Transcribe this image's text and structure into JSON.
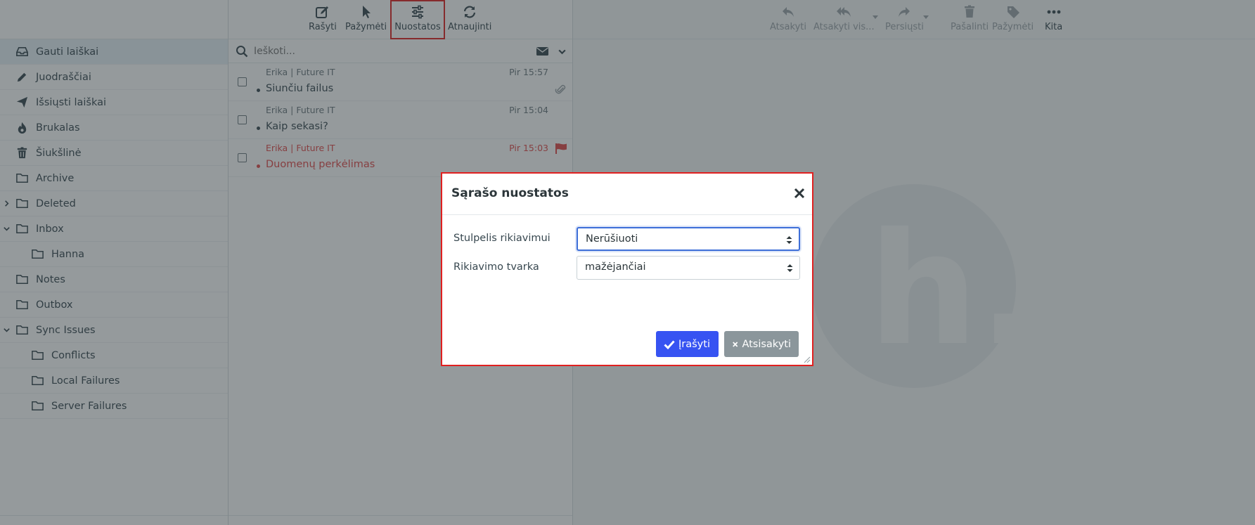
{
  "main_toolbar": {
    "compose": "Rašyti",
    "select": "Pažymėti",
    "options": "Nuostatos",
    "refresh": "Atnaujinti"
  },
  "preview_toolbar": {
    "reply": "Atsakyti",
    "reply_all": "Atsakyti vis...",
    "forward": "Persiųsti",
    "delete": "Pašalinti",
    "mark": "Pažymėti",
    "more": "Kita"
  },
  "sidebar": {
    "folders": [
      {
        "label": "Gauti laiškai",
        "icon": "inbox-icon",
        "selected": true
      },
      {
        "label": "Juodraščiai",
        "icon": "pencil-icon"
      },
      {
        "label": "Išsiųsti laiškai",
        "icon": "paper-plane-icon"
      },
      {
        "label": "Brukalas",
        "icon": "fire-icon"
      },
      {
        "label": "Šiukšlinė",
        "icon": "trash-icon"
      },
      {
        "label": "Archive",
        "icon": "folder-icon"
      },
      {
        "label": "Deleted",
        "icon": "folder-icon",
        "collapsed": true
      },
      {
        "label": "Inbox",
        "icon": "folder-icon",
        "expanded": true
      },
      {
        "label": "Hanna",
        "icon": "folder-icon",
        "level": 1
      },
      {
        "label": "Notes",
        "icon": "folder-icon"
      },
      {
        "label": "Outbox",
        "icon": "folder-icon"
      },
      {
        "label": "Sync Issues",
        "icon": "folder-icon",
        "expanded": true
      },
      {
        "label": "Conflicts",
        "icon": "folder-icon",
        "level": 1
      },
      {
        "label": "Local Failures",
        "icon": "folder-icon",
        "level": 1
      },
      {
        "label": "Server Failures",
        "icon": "folder-icon",
        "level": 1
      }
    ]
  },
  "search": {
    "placeholder": "Ieškoti..."
  },
  "messages": [
    {
      "from": "Erika | Future IT",
      "date": "Pir 15:57",
      "subject": "Siunčiu failus",
      "attachment": true,
      "flagged": false
    },
    {
      "from": "Erika | Future IT",
      "date": "Pir 15:04",
      "subject": "Kaip sekasi?",
      "attachment": false,
      "flagged": false
    },
    {
      "from": "Erika | Future IT",
      "date": "Pir 15:03",
      "subject": "Duomenų perkėlimas",
      "attachment": false,
      "flagged": true
    }
  ],
  "dialog": {
    "title": "Sąrašo nuostatos",
    "sort_column_label": "Stulpelis rikiavimui",
    "sort_column_value": "Nerūšiuoti",
    "sort_order_label": "Rikiavimo tvarka",
    "sort_order_value": "mažėjančiai",
    "save_label": "Įrašyti",
    "cancel_label": "Atsisakyti"
  },
  "colors": {
    "accent": "#3753f2",
    "flag": "#e04949",
    "highlight_border": "#e02020",
    "cancel": "#8b969b"
  }
}
